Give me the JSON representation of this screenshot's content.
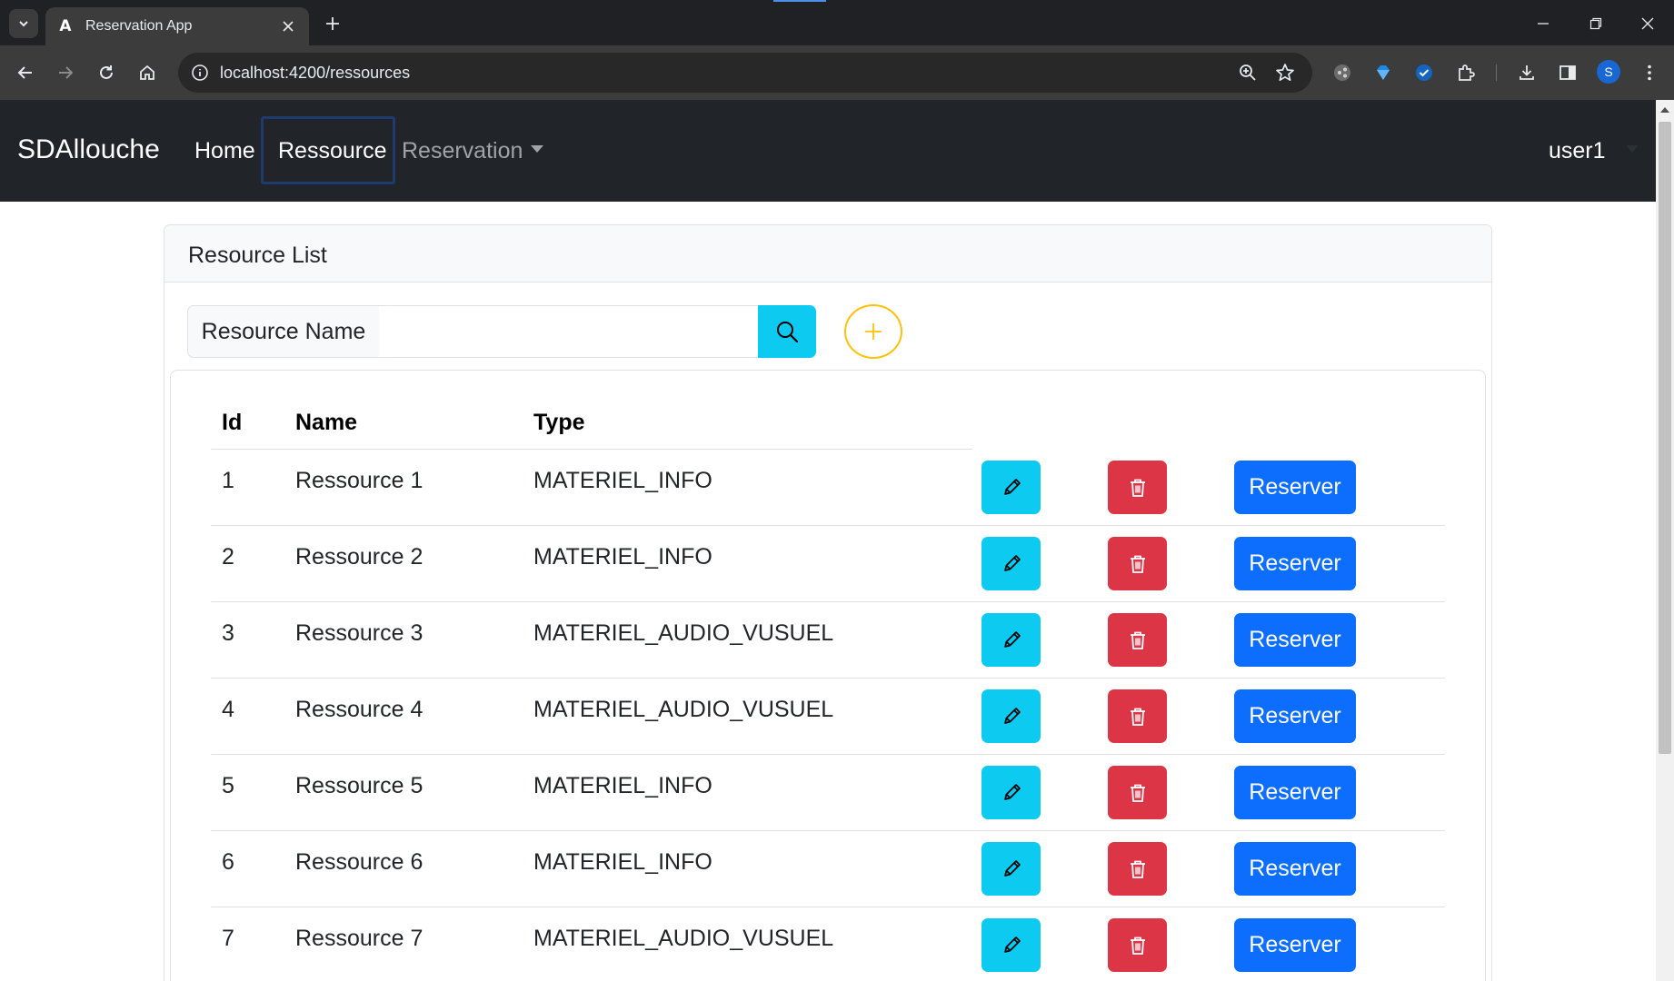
{
  "browser": {
    "tab_title": "Reservation App",
    "favicon_letter": "A",
    "url": "localhost:4200/ressources",
    "profile_initial": "S"
  },
  "navbar": {
    "brand": "SDAllouche",
    "links": [
      "Home",
      "Ressource",
      "Reservation"
    ],
    "active_link": "Ressource",
    "user": "user1"
  },
  "card": {
    "title": "Resource List"
  },
  "search": {
    "label": "Resource Name",
    "value": "",
    "placeholder": ""
  },
  "table": {
    "headers": [
      "Id",
      "Name",
      "Type"
    ],
    "rows": [
      {
        "id": "1",
        "name": "Ressource 1",
        "type": "MATERIEL_INFO"
      },
      {
        "id": "2",
        "name": "Ressource 2",
        "type": "MATERIEL_INFO"
      },
      {
        "id": "3",
        "name": "Ressource 3",
        "type": "MATERIEL_AUDIO_VUSUEL"
      },
      {
        "id": "4",
        "name": "Ressource 4",
        "type": "MATERIEL_AUDIO_VUSUEL"
      },
      {
        "id": "5",
        "name": "Ressource 5",
        "type": "MATERIEL_INFO"
      },
      {
        "id": "6",
        "name": "Ressource 6",
        "type": "MATERIEL_INFO"
      },
      {
        "id": "7",
        "name": "Ressource 7",
        "type": "MATERIEL_AUDIO_VUSUEL"
      }
    ],
    "reserve_label": "Reserver"
  },
  "colors": {
    "navbar_bg": "#212529",
    "info": "#0dcaf0",
    "danger": "#dc3545",
    "primary": "#0d6efd",
    "warning": "#ffc107"
  },
  "icons": {
    "edit": "pencil-icon",
    "delete": "trash-icon",
    "search": "search-icon",
    "add": "plus-icon"
  }
}
